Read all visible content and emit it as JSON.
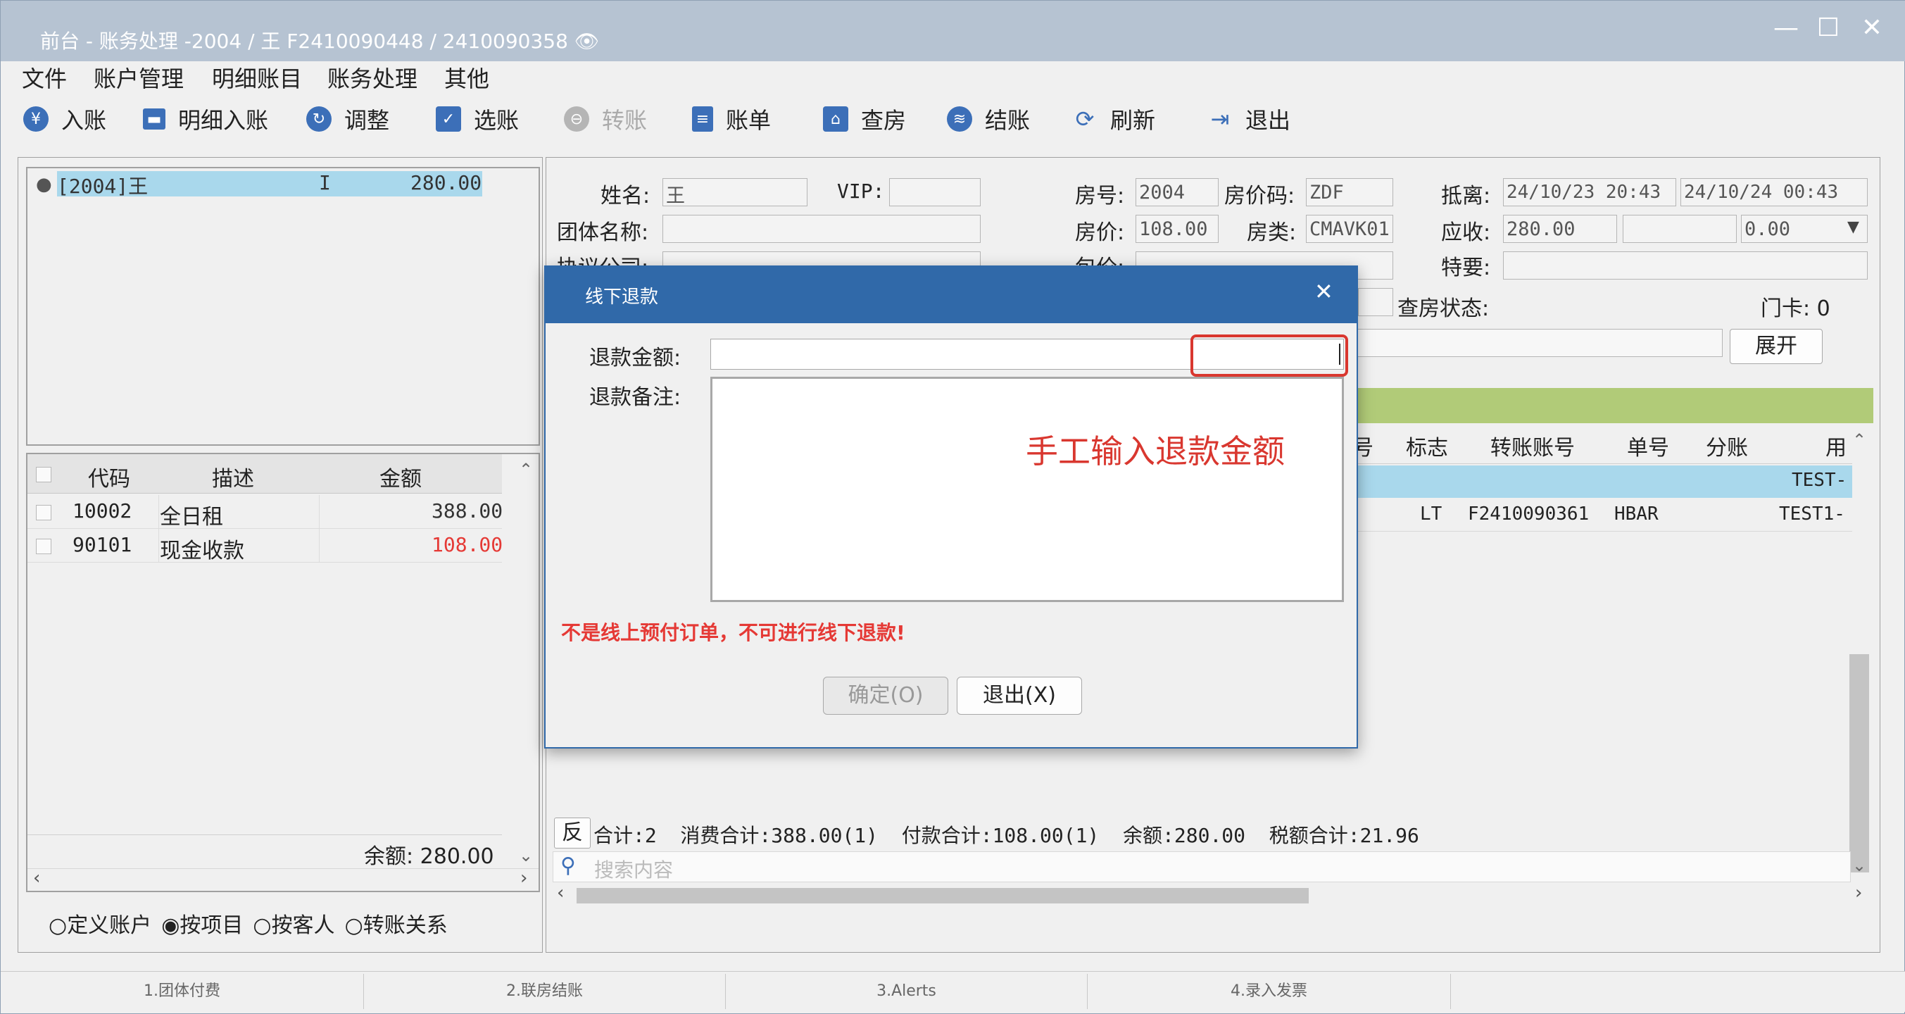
{
  "window": {
    "title": "前台 - 账务处理 -2004 / 王 F2410090448 / 2410090358 👁",
    "controls": {
      "minimize": "—",
      "maximize": "☐",
      "close": "✕"
    }
  },
  "menubar": [
    "文件",
    "账户管理",
    "明细账目",
    "账务处理",
    "其他"
  ],
  "toolbar": {
    "post": "入账",
    "detail_post": "明细入账",
    "adjust": "调整",
    "select": "选账",
    "transfer": "转账",
    "bill": "账单",
    "check_room": "查房",
    "checkout": "结账",
    "refresh": "刷新",
    "exit": "退出"
  },
  "accounts": {
    "selected": "[2004]王",
    "status": "I",
    "amount": "280.00"
  },
  "items": {
    "headers": [
      "代码",
      "描述",
      "金额"
    ],
    "rows": [
      {
        "code": "10002",
        "desc": "全日租",
        "amount": "388.00"
      },
      {
        "code": "90101",
        "desc": "现金收款",
        "amount": "108.00"
      }
    ],
    "balance": "余额: 280.00"
  },
  "view_mode": {
    "options": [
      "定义账户",
      "按项目",
      "按客人",
      "转账关系"
    ],
    "selected": "按项目"
  },
  "info": {
    "name_label": "姓名:",
    "name_value": "王",
    "vip_label": "VIP:",
    "vip_value": "",
    "group_label": "团体名称:",
    "group_value": "",
    "agreement_label": "协议公司:",
    "room_no_label": "房号:",
    "room_no_value": "2004",
    "rate_code_label": "房价码:",
    "rate_code_value": "ZDF",
    "rate_label": "房价:",
    "rate_value": "108.00",
    "room_type_label": "房类:",
    "room_type_value": "CMAVK01",
    "package_label": "包价:",
    "arrive_label": "抵离:",
    "arrive_value": "24/10/23 20:43",
    "depart_value": "24/10/24 00:43",
    "receivable_label": "应收:",
    "receivable_value": "280.00",
    "receivable_value2": "",
    "receivable_value3": "0.00",
    "special_label": "特要:",
    "special_value": "",
    "check_status_label": "查房状态:",
    "door_card": "门卡: 0",
    "expand_button": "展开"
  },
  "grid": {
    "headers": [
      "号",
      "标志",
      "转账账号",
      "单号",
      "分账",
      "用"
    ],
    "row1": {
      "user": "TEST-"
    },
    "row2": {
      "flag": "LT",
      "transfer": "F2410090361",
      "bill_no": "HBAR",
      "user": "TEST1-"
    }
  },
  "summary": {
    "reverse": "反",
    "text": "合计:2  消费合计:388.00(1)  付款合计:108.00(1)  余额:280.00  税额合计:21.96"
  },
  "search": {
    "placeholder": "搜索内容"
  },
  "dialog": {
    "title": "线下退款",
    "close": "✕",
    "amount_label": "退款金额:",
    "amount_value": "",
    "remark_label": "退款备注:",
    "remark_value": "",
    "annotation": "手工输入退款金额",
    "error": "不是线上预付订单，不可进行线下退款!",
    "confirm": "确定(O)",
    "exit": "退出(X)"
  },
  "bottom_tabs": [
    "1.团体付费",
    "2.联房结账",
    "3.Alerts",
    "4.录入发票"
  ],
  "colors": {
    "titlebar": "#b6c3d2",
    "dialog_header": "#3069a9",
    "highlight": "#a9d8ec",
    "grid_header": "#b1cb78",
    "error": "#e53935",
    "annotation_box": "#d9372f"
  }
}
